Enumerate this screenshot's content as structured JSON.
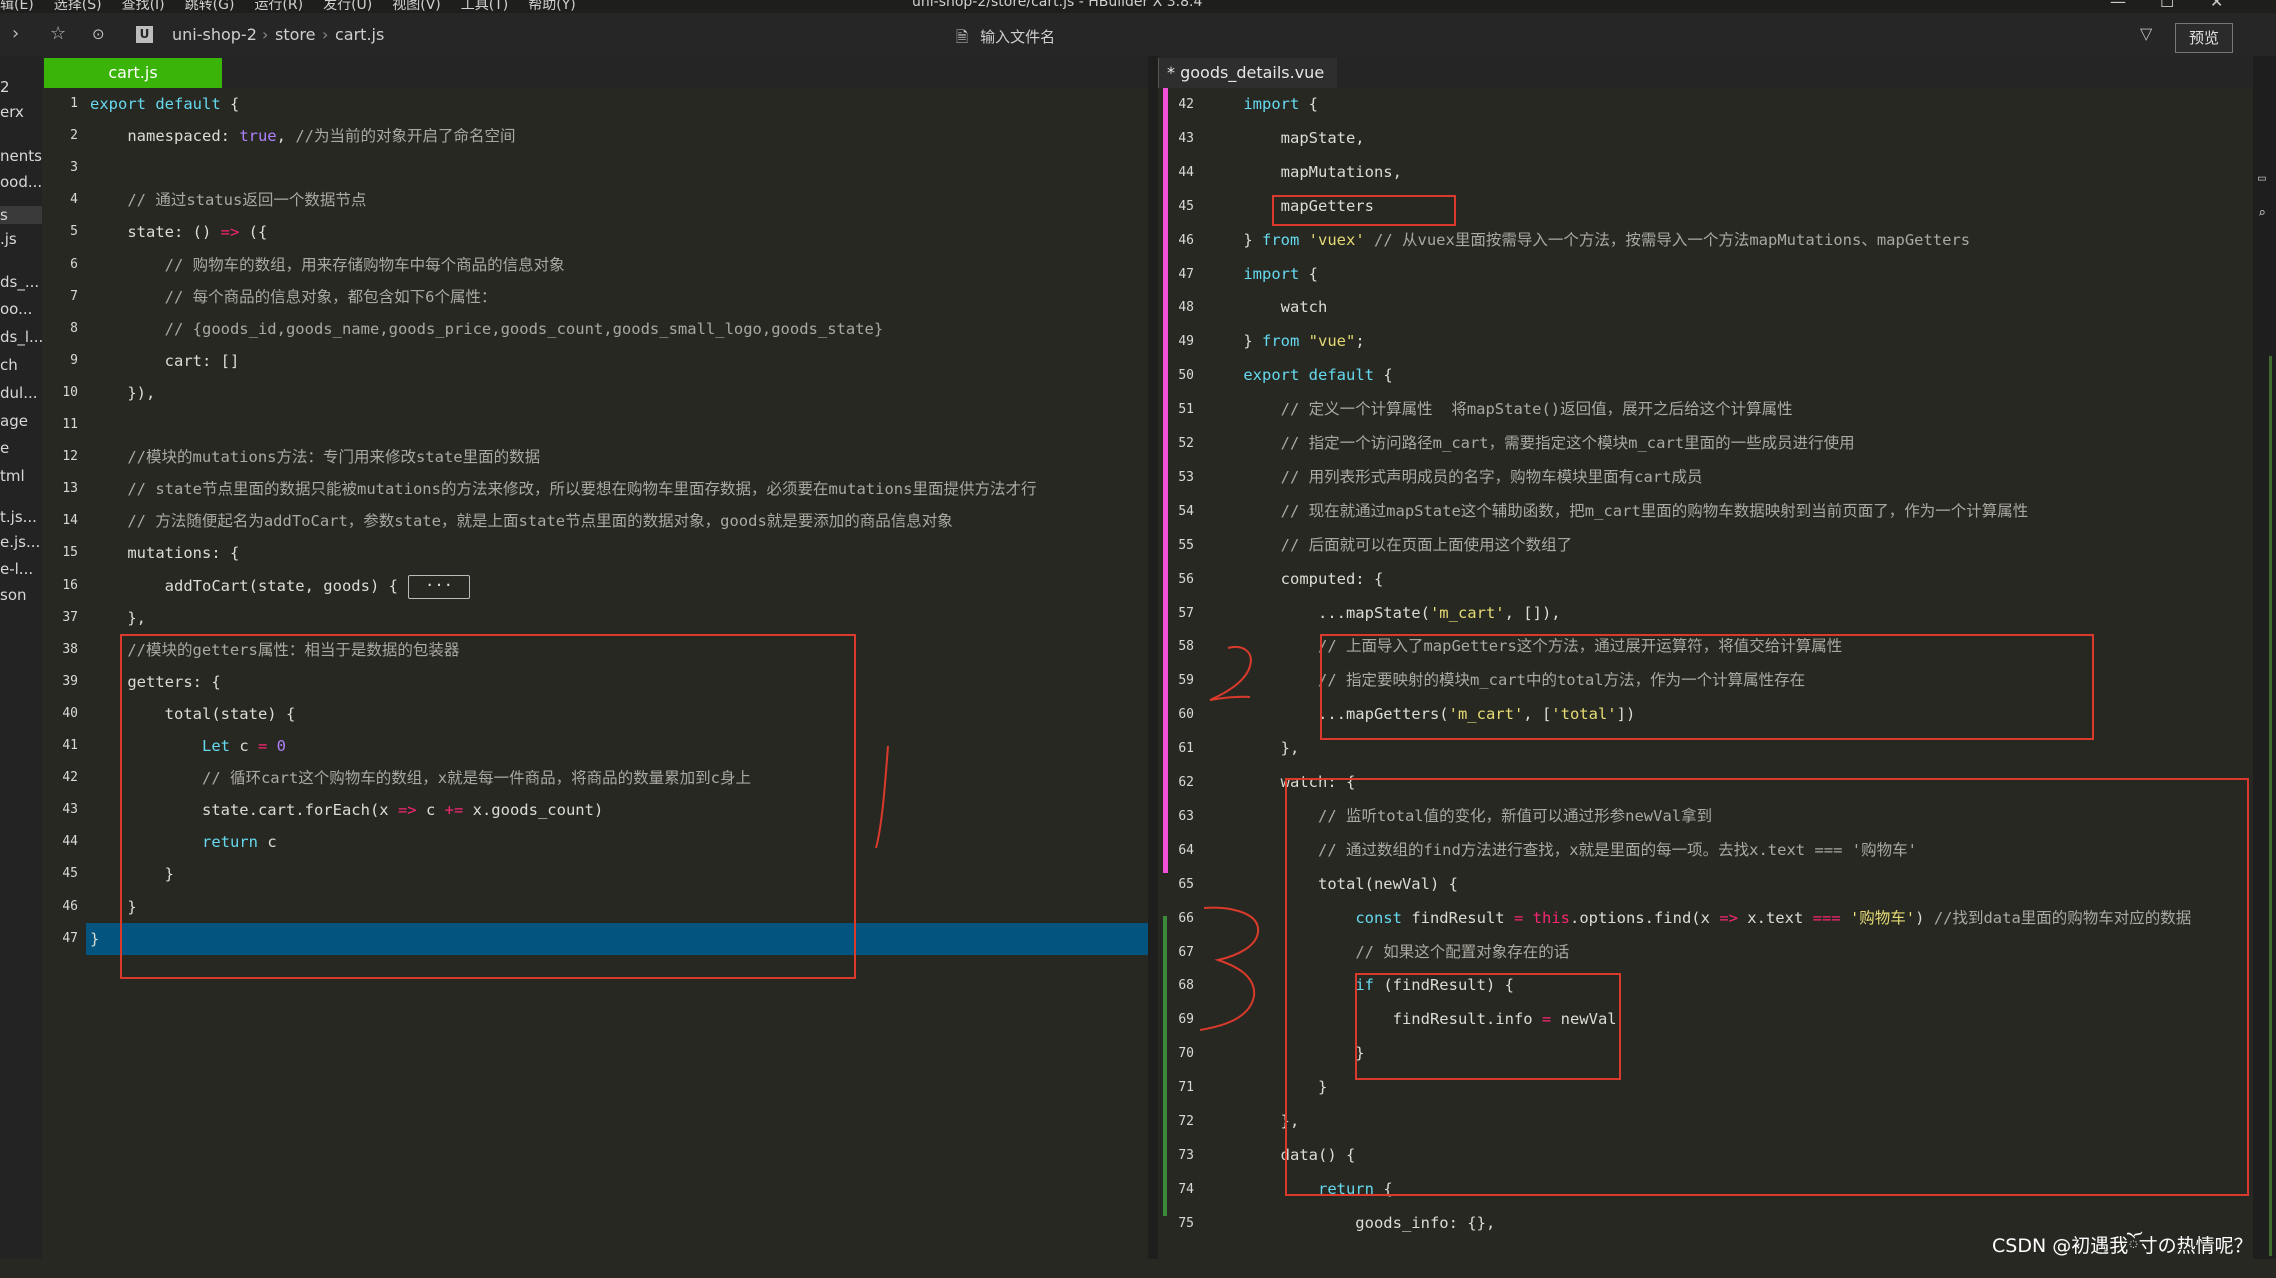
{
  "menubar": {
    "items": [
      "辑(E)",
      "选择(S)",
      "查找(I)",
      "跳转(G)",
      "运行(R)",
      "发行(U)",
      "视图(V)",
      "工具(T)",
      "帮助(Y)"
    ],
    "window_title": "uni-shop-2/store/cart.js - HBuilder X 3.8.4"
  },
  "toolbar": {
    "breadcrumb": [
      "uni-shop-2",
      "store",
      "cart.js"
    ],
    "project_badge": "U",
    "file_search_placeholder": "输入文件名",
    "preview_label": "预览"
  },
  "tree": {
    "items": [
      "2",
      "erx",
      "nents",
      "ood...",
      "s",
      ".js",
      "ds_...",
      "oo...",
      "ds_l...",
      "ch",
      "dul...",
      "age",
      "e",
      "tml",
      "t.js...",
      "e.js...",
      "e-l...",
      "son"
    ]
  },
  "left_tab": {
    "label": "cart.js"
  },
  "right_tab": {
    "label": "* goods_details.vue"
  },
  "left_code": [
    {
      "n": "1",
      "t": "export default {"
    },
    {
      "n": "2",
      "t": "    namespaced: true, //为当前的对象开启了命名空间"
    },
    {
      "n": "3",
      "t": ""
    },
    {
      "n": "4",
      "t": "    // 通过status返回一个数据节点"
    },
    {
      "n": "5",
      "t": "    state: () => ({"
    },
    {
      "n": "6",
      "t": "        // 购物车的数组，用来存储购物车中每个商品的信息对象"
    },
    {
      "n": "7",
      "t": "        // 每个商品的信息对象，都包含如下6个属性："
    },
    {
      "n": "8",
      "t": "        // {goods_id,goods_name,goods_price,goods_count,goods_small_logo,goods_state}"
    },
    {
      "n": "9",
      "t": "        cart: []"
    },
    {
      "n": "10",
      "t": "    }),"
    },
    {
      "n": "11",
      "t": ""
    },
    {
      "n": "12",
      "t": "    //模块的mutations方法：专门用来修改state里面的数据"
    },
    {
      "n": "13",
      "t": "    // state节点里面的数据只能被mutations的方法来修改，所以要想在购物车里面存数据，必须要在mutations里面提供方法才行"
    },
    {
      "n": "14",
      "t": "    // 方法随便起名为addToCart，参数state，就是上面state节点里面的数据对象，goods就是要添加的商品信息对象"
    },
    {
      "n": "15",
      "t": "    mutations: {"
    },
    {
      "n": "16",
      "t": "        addToCart(state, goods) {"
    },
    {
      "n": "37",
      "t": "    },"
    },
    {
      "n": "38",
      "t": "    //模块的getters属性：相当于是数据的包装器"
    },
    {
      "n": "39",
      "t": "    getters: {"
    },
    {
      "n": "40",
      "t": "        total(state) {"
    },
    {
      "n": "41",
      "t": "            Let c = 0"
    },
    {
      "n": "42",
      "t": "            // 循环cart这个购物车的数组，x就是每一件商品，将商品的数量累加到c身上"
    },
    {
      "n": "43",
      "t": "            state.cart.forEach(x => c += x.goods_count)"
    },
    {
      "n": "44",
      "t": "            return c"
    },
    {
      "n": "45",
      "t": "        }"
    },
    {
      "n": "46",
      "t": "    }"
    },
    {
      "n": "47",
      "t": "}"
    }
  ],
  "fold_placeholder": "···",
  "right_code": [
    {
      "n": "42",
      "t": "    import {"
    },
    {
      "n": "43",
      "t": "        mapState,"
    },
    {
      "n": "44",
      "t": "        mapMutations,"
    },
    {
      "n": "45",
      "t": "        mapGetters"
    },
    {
      "n": "46",
      "t": "    } from 'vuex' // 从vuex里面按需导入一个方法，按需导入一个方法mapMutations、mapGetters"
    },
    {
      "n": "47",
      "t": "    import {"
    },
    {
      "n": "48",
      "t": "        watch"
    },
    {
      "n": "49",
      "t": "    } from \"vue\";"
    },
    {
      "n": "50",
      "t": "    export default {"
    },
    {
      "n": "51",
      "t": "        // 定义一个计算属性  将mapState()返回值，展开之后给这个计算属性"
    },
    {
      "n": "52",
      "t": "        // 指定一个访问路径m_cart，需要指定这个模块m_cart里面的一些成员进行使用"
    },
    {
      "n": "53",
      "t": "        // 用列表形式声明成员的名字，购物车模块里面有cart成员"
    },
    {
      "n": "54",
      "t": "        // 现在就通过mapState这个辅助函数，把m_cart里面的购物车数据映射到当前页面了，作为一个计算属性"
    },
    {
      "n": "55",
      "t": "        // 后面就可以在页面上面使用这个数组了"
    },
    {
      "n": "56",
      "t": "        computed: {"
    },
    {
      "n": "57",
      "t": "            ...mapState('m_cart', []),"
    },
    {
      "n": "58",
      "t": "            // 上面导入了mapGetters这个方法，通过展开运算符，将值交给计算属性"
    },
    {
      "n": "59",
      "t": "            // 指定要映射的模块m_cart中的total方法，作为一个计算属性存在"
    },
    {
      "n": "60",
      "t": "            ...mapGetters('m_cart', ['total'])"
    },
    {
      "n": "61",
      "t": "        },"
    },
    {
      "n": "62",
      "t": "        watch: {"
    },
    {
      "n": "63",
      "t": "            // 监听total值的变化，新值可以通过形参newVal拿到"
    },
    {
      "n": "64",
      "t": "            // 通过数组的find方法进行查找，x就是里面的每一项。去找x.text === '购物车'"
    },
    {
      "n": "65",
      "t": "            total(newVal) {"
    },
    {
      "n": "66",
      "t": "                const findResult = this.options.find(x => x.text === '购物车') //找到data里面的购物车对应的数据"
    },
    {
      "n": "67",
      "t": "                // 如果这个配置对象存在的话"
    },
    {
      "n": "68",
      "t": "                if (findResult) {"
    },
    {
      "n": "69",
      "t": "                    findResult.info = newVal"
    },
    {
      "n": "70",
      "t": "                }"
    },
    {
      "n": "71",
      "t": "            }"
    },
    {
      "n": "72",
      "t": "        },"
    },
    {
      "n": "73",
      "t": "        data() {"
    },
    {
      "n": "74",
      "t": "            return {"
    },
    {
      "n": "75",
      "t": "                goods_info: {},"
    }
  ],
  "watermark": "CSDN @初遇我ོ寸の热情呢？"
}
